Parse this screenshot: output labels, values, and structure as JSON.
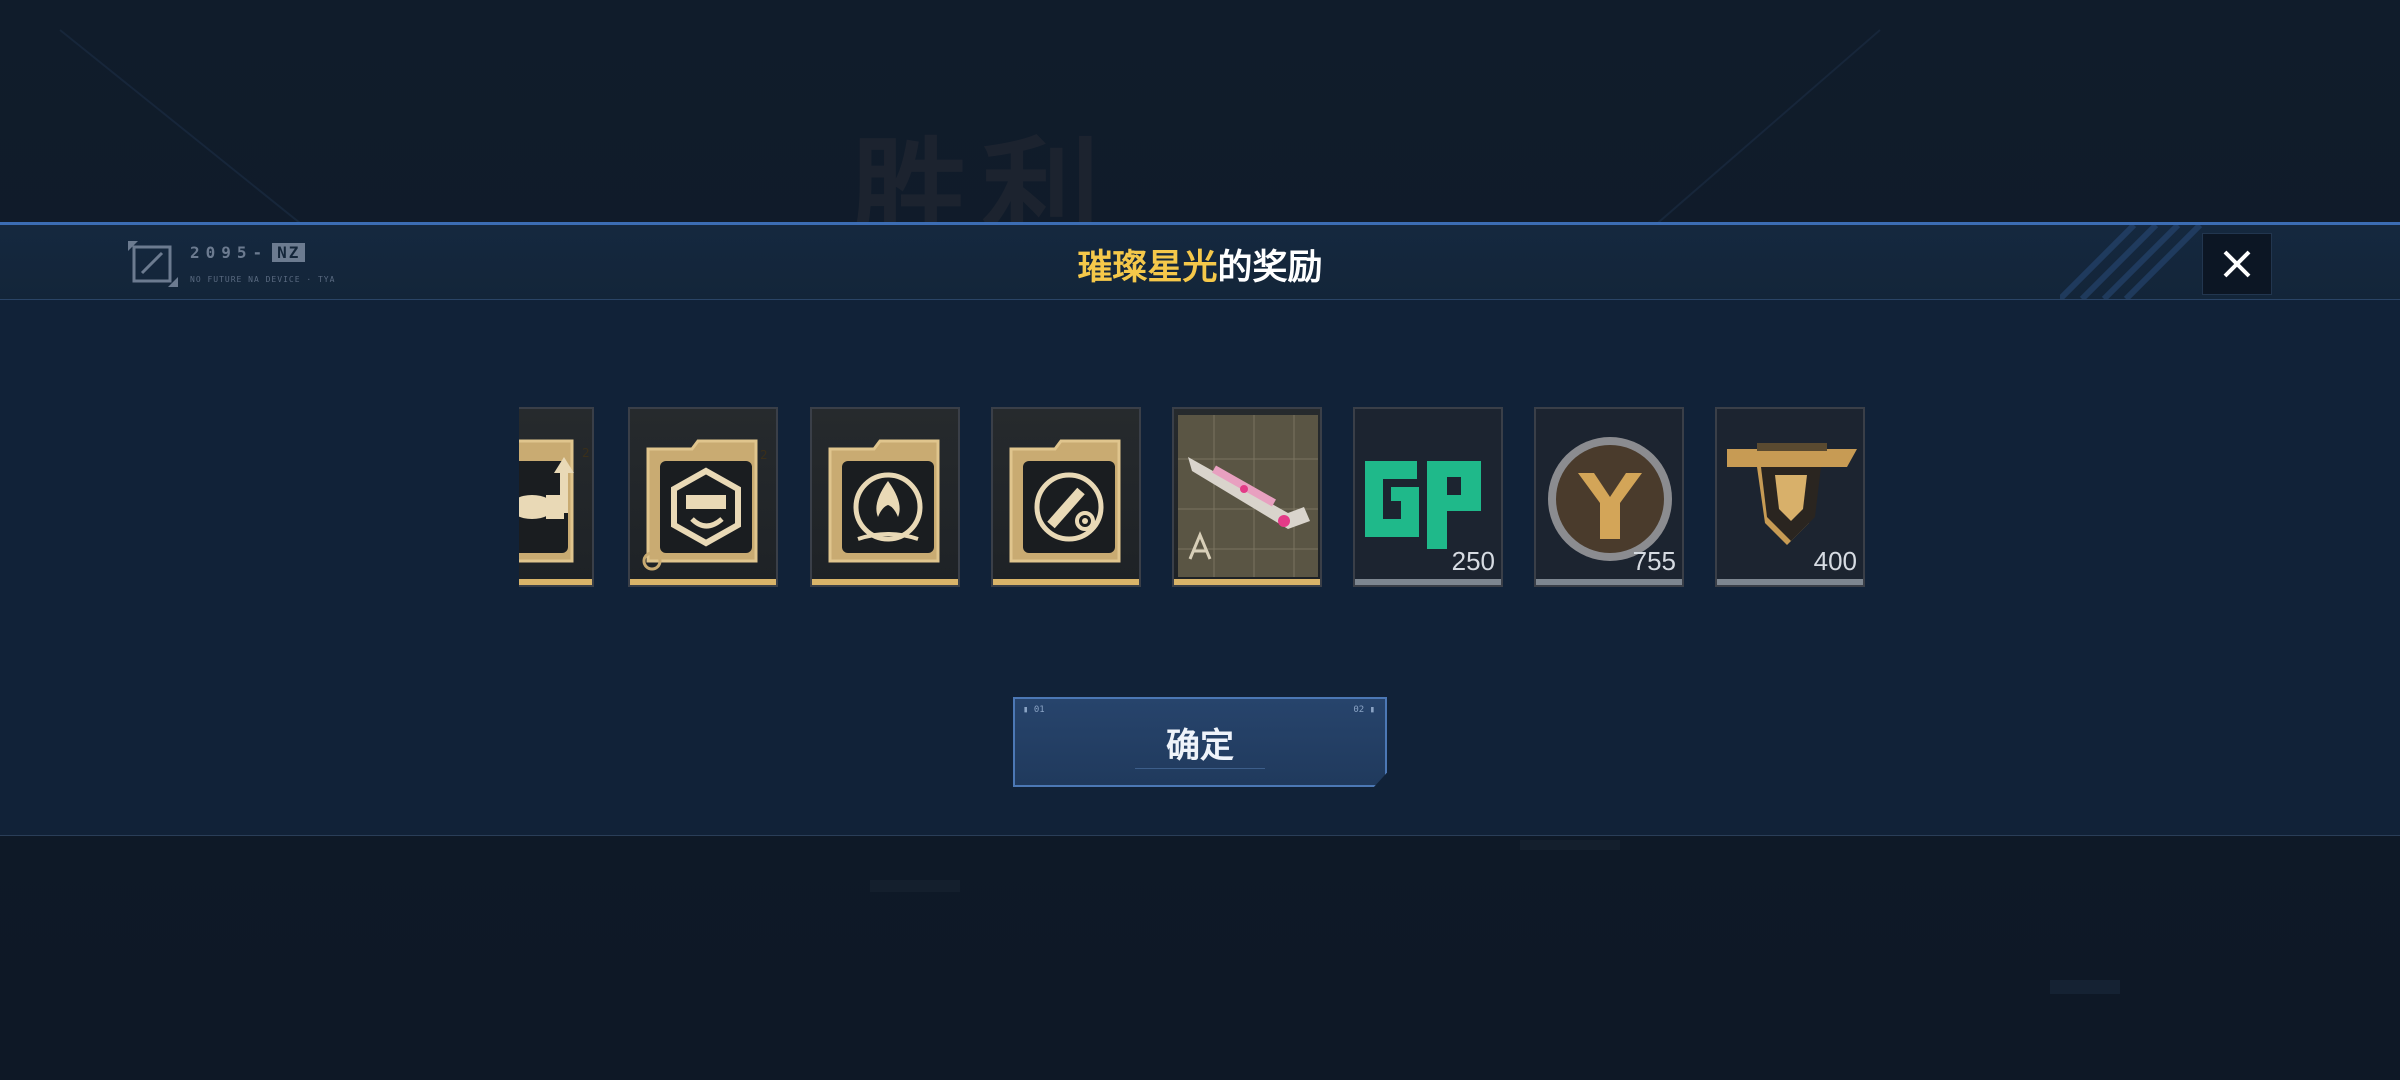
{
  "background": {
    "victory_text": "胜利"
  },
  "dialog": {
    "logo_code": "2095-",
    "logo_badge": "NZ",
    "logo_sub": "NO FUTURE NA DEVICE · TYA",
    "title_highlight": "璀璨星光",
    "title_rest": "的奖励",
    "close_icon": "close-icon"
  },
  "rewards": [
    {
      "icon": "ammo-upgrade-card-icon",
      "quantity": null,
      "rarity": "gold"
    },
    {
      "icon": "weapon-mod-card-icon",
      "quantity": null,
      "rarity": "gold"
    },
    {
      "icon": "flame-emblem-card-icon",
      "quantity": null,
      "rarity": "gold"
    },
    {
      "icon": "rocket-emblem-card-icon",
      "quantity": null,
      "rarity": "gold"
    },
    {
      "icon": "weapon-blueprint-icon",
      "quantity": null,
      "rarity": "gold"
    },
    {
      "icon": "gp-currency-icon",
      "quantity": "250",
      "rarity": "grey"
    },
    {
      "icon": "bronze-coin-icon",
      "quantity": "755",
      "rarity": "grey"
    },
    {
      "icon": "rank-badge-icon",
      "quantity": "400",
      "rarity": "grey"
    }
  ],
  "confirm_button": {
    "label": "确定"
  },
  "colors": {
    "accent_gold": "#f5c84a",
    "modal_bg": "#112238",
    "border_blue": "#3c6db4",
    "gp_green": "#1fb98a"
  }
}
